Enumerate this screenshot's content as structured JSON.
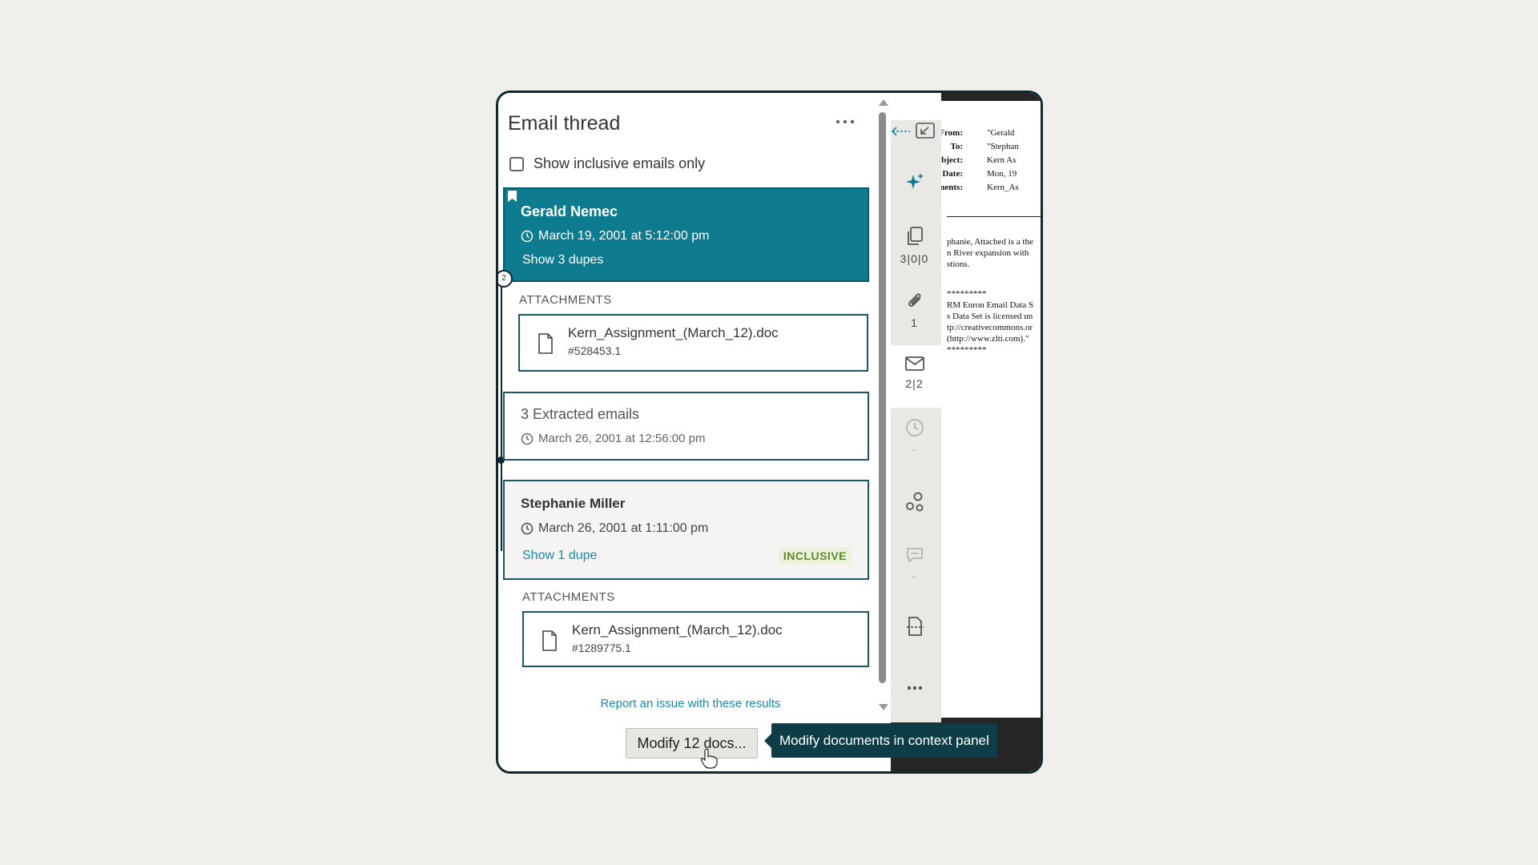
{
  "panel": {
    "title": "Email thread",
    "show_inclusive_label": "Show inclusive emails only",
    "thread_node_badge": "2"
  },
  "emails": [
    {
      "name": "Gerald Nemec",
      "time": "March 19, 2001 at 5:12:00 pm",
      "dupes_link": "Show 3 dupes",
      "attachments_label": "ATTACHMENTS",
      "attachment": {
        "name": "Kern_Assignment_(March_12).doc",
        "id": "#528453.1"
      }
    },
    {
      "name": "3 Extracted emails",
      "time": "March 26, 2001 at 12:56:00 pm"
    },
    {
      "name": "Stephanie Miller",
      "time": "March 26, 2001 at 1:11:00 pm",
      "dupes_link": "Show 1 dupe",
      "badge": "INCLUSIVE",
      "attachments_label": "ATTACHMENTS",
      "attachment": {
        "name": "Kern_Assignment_(March_12).doc",
        "id": "#1289775.1"
      }
    }
  ],
  "report_link": "Report an issue with these results",
  "modify_button": "Modify 12 docs...",
  "tooltip": "Modify documents in context panel",
  "sidebar": {
    "duplicates_count": "3|0|0",
    "attachments_count": "1",
    "email_count": "2|2",
    "history_count": "-",
    "comments_count": "-"
  },
  "document": {
    "header": [
      {
        "label": "From:",
        "value": "\"Gerald"
      },
      {
        "label": "To:",
        "value": "\"Stephan"
      },
      {
        "label": "Subject:",
        "value": "Kern As"
      },
      {
        "label": "Date:",
        "value": "Mon, 19"
      },
      {
        "label": "Attachments:",
        "value": "Kern_As"
      }
    ],
    "body_lines": [
      "phanie, Attached is a the",
      "n River expansion with",
      "stions.",
      "*********",
      "RM Enron Email Data S",
      "s Data Set is licensed un",
      "tp://creativecommons.or",
      " (http://www.zlti.com).\"",
      "*********"
    ]
  },
  "colors": {
    "accent": "#0e7c8e",
    "border": "#1b5766",
    "link": "#1a8aa8",
    "inclusive_bg": "#ecf2df",
    "inclusive_text": "#5d8a2a",
    "tooltip_bg": "#0f3d47"
  }
}
